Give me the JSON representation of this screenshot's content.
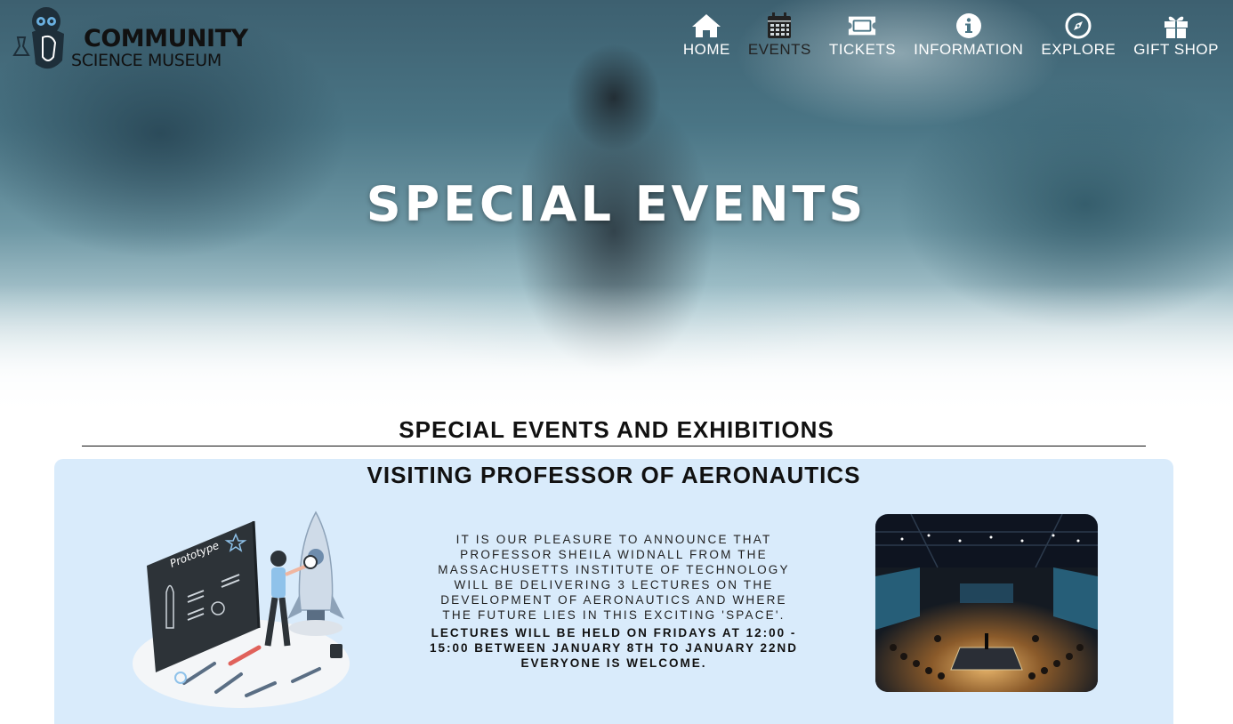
{
  "brand": {
    "line1": "COMMUNITY",
    "line2": "SCIENCE MUSEUM"
  },
  "nav": {
    "items": [
      {
        "label": "HOME",
        "icon": "home-icon"
      },
      {
        "label": "EVENTS",
        "icon": "calendar-icon",
        "active": true
      },
      {
        "label": "TICKETS",
        "icon": "ticket-icon"
      },
      {
        "label": "INFORMATION",
        "icon": "info-icon"
      },
      {
        "label": "EXPLORE",
        "icon": "compass-icon"
      },
      {
        "label": "GIFT SHOP",
        "icon": "gift-icon"
      }
    ]
  },
  "hero": {
    "title": "SPECIAL EVENTS"
  },
  "section": {
    "title": "SPECIAL EVENTS AND EXHIBITIONS"
  },
  "event": {
    "title": "VISITING PROFESSOR OF AERONAUTICS",
    "illustration_label": "Prototype",
    "description": "IT IS OUR PLEASURE TO ANNOUNCE THAT PROFESSOR SHEILA WIDNALL FROM THE MASSACHUSETTS INSTITUTE OF TECHNOLOGY WILL BE DELIVERING 3 LECTURES ON THE DEVELOPMENT OF AERONAUTICS AND WHERE THE FUTURE LIES IN THIS EXCITING 'SPACE'.",
    "schedule": "LECTURES WILL BE HELD ON FRIDAYS AT 12:00 - 15:00 BETWEEN JANUARY 8TH TO JANUARY 22ND EVERYONE IS WELCOME."
  },
  "colors": {
    "card_background": "#d9ebfb",
    "nav_text": "#ffffff",
    "nav_active_text": "#222222"
  }
}
